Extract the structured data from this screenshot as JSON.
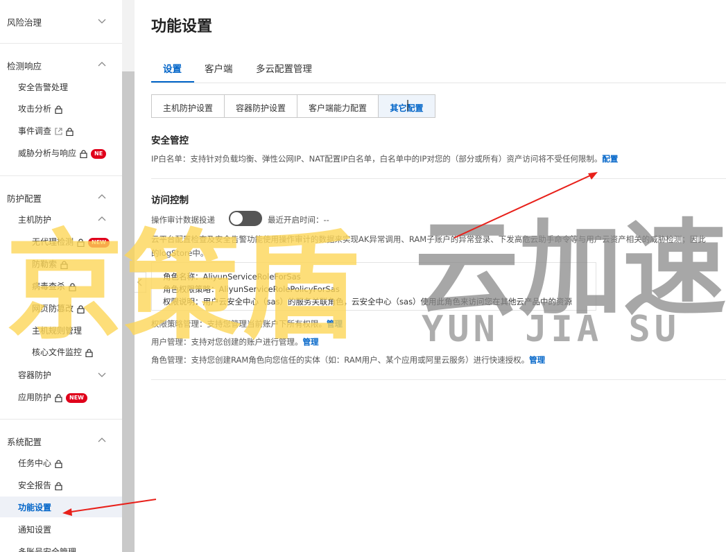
{
  "sidebar": {
    "sections": [
      {
        "label": "风险治理",
        "expanded": false
      },
      {
        "label": "检测响应",
        "expanded": true
      },
      {
        "label": "防护配置",
        "expanded": true
      },
      {
        "label": "系统配置",
        "expanded": true
      }
    ],
    "items": {
      "alert": "安全告警处理",
      "attack": "攻击分析",
      "investigate": "事件调查",
      "threat": "威胁分析与响应",
      "threat_badge": "NE",
      "host_protect": "主机防护",
      "agentless": "无代理检测",
      "agentless_badge": "NEW",
      "ransom": "防勒索",
      "virus": "病毒查杀",
      "webtamper": "网页防篡改",
      "host_rules": "主机规则管理",
      "core_file": "核心文件监控",
      "container": "容器防护",
      "app": "应用防护",
      "app_badge": "NEW",
      "task": "任务中心",
      "report": "安全报告",
      "feature": "功能设置",
      "notify": "通知设置",
      "multi": "多账号安全管理"
    }
  },
  "main": {
    "title": "功能设置",
    "tabs": [
      "设置",
      "客户端",
      "多云配置管理"
    ],
    "segments": [
      "主机防护设置",
      "容器防护设置",
      "客户端能力配置",
      "其它配置"
    ],
    "security_title": "安全管控",
    "ip_text": "IP白名单：支持针对负载均衡、弹性公网IP、NAT配置IP白名单，白名单中的IP对您的（部分或所有）资产访问将不受任何限制。",
    "ip_link": "配置",
    "access_title": "访问控制",
    "audit_label": "操作审计数据投递",
    "audit_last": "最近开启时间：--",
    "audit_desc1": "云平台配置检查及安全告警功能使用操作审计的数据来实现AK异常调用、RAM子账户的异常登录、下发高危云助手命令等与用户云资产相关的威胁检测；因此",
    "audit_desc2": "的logStore中。",
    "role_name": "角色名称：AliyunServiceRoleForSas",
    "role_policy": "角色权限策略：AliyunServiceRolePolicyForSas",
    "role_desc": "权限说明：用户云安全中心（sas）的服务关联角色，云安全中心（sas）使用此角色来访问您在其他云产品中的资源",
    "policy_text": "权限策略管理：支持您管理当前账户下所有权限。",
    "user_text": "用户管理：支持对您创建的账户进行管理。",
    "rolemgr_text": "角色管理：支持您创建RAM角色向您信任的实体（如：RAM用户、某个应用或阿里云服务）进行快速授权。",
    "manage_link": "管理"
  },
  "watermark": {
    "cn_left": "京策盾",
    "cn_right": "云加速",
    "en": "YUN JIA SU"
  },
  "colors": {
    "accent": "#0064c8",
    "badge": "#e0001b",
    "watermark_yellow": "#fcd658",
    "watermark_gray": "#8a8a8a",
    "arrow": "#e8201a"
  }
}
